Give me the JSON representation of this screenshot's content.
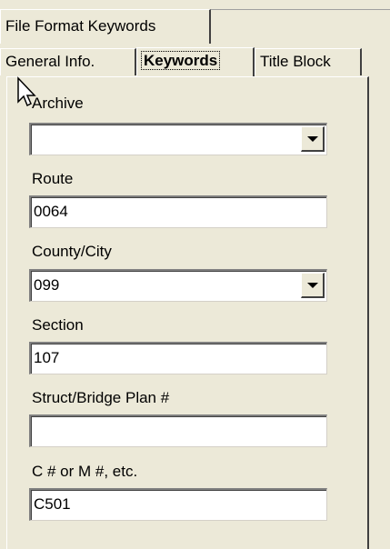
{
  "tabs_row1": [
    {
      "label": "File Format Keywords"
    }
  ],
  "tabs_row2": [
    {
      "label": "General Info."
    },
    {
      "label": "Keywords",
      "selected": true
    },
    {
      "label": "Title Block"
    }
  ],
  "form": {
    "archive": {
      "label": "Archive",
      "value": ""
    },
    "route": {
      "label": "Route",
      "value": "0064"
    },
    "county_city": {
      "label": "County/City",
      "value": "099"
    },
    "section": {
      "label": "Section",
      "value": "107"
    },
    "struct_bridge": {
      "label": "Struct/Bridge Plan #",
      "value": ""
    },
    "c_m": {
      "label": "C # or M #, etc.",
      "value": "C501"
    }
  },
  "icons": {
    "cursor": "mouse-pointer-icon",
    "dropdown": "dropdown-arrow-icon"
  },
  "colors": {
    "background": "#ece9d8",
    "field_background": "#ffffff"
  }
}
